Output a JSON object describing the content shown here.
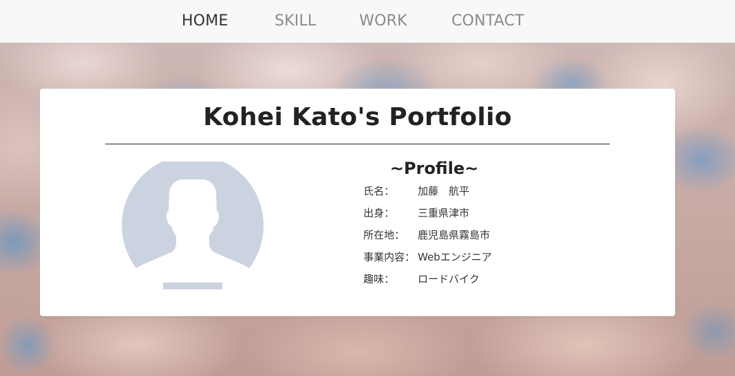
{
  "nav": {
    "items": [
      {
        "label": "HOME",
        "active": true
      },
      {
        "label": "SKILL",
        "active": false
      },
      {
        "label": "WORK",
        "active": false
      },
      {
        "label": "CONTACT",
        "active": false
      }
    ]
  },
  "card": {
    "title": "Kohei Kato's Portfolio",
    "avatar_icon": "user-silhouette-icon",
    "profile": {
      "heading": "~Profile~",
      "rows": [
        {
          "label": "氏名：",
          "value": "加藤　航平"
        },
        {
          "label": "出身：",
          "value": "三重県津市"
        },
        {
          "label": "所在地：",
          "value": "鹿児島県霧島市"
        },
        {
          "label": "事業内容：",
          "value": "Webエンジニア"
        },
        {
          "label": "趣味：",
          "value": "ロードバイク"
        }
      ]
    }
  },
  "colors": {
    "nav_background": "#f7f8f9",
    "nav_active": "#333333",
    "nav_inactive": "#8a8a8a",
    "card_background": "#ffffff",
    "avatar_fill": "#ccd3e0"
  }
}
